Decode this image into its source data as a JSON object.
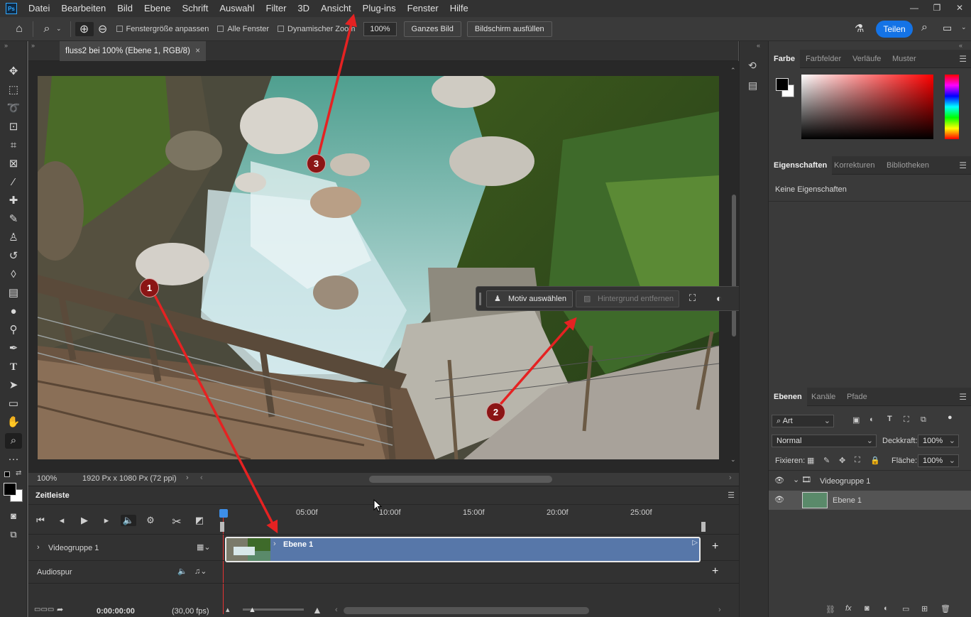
{
  "menubar": {
    "items": [
      "Datei",
      "Bearbeiten",
      "Bild",
      "Ebene",
      "Schrift",
      "Auswahl",
      "Filter",
      "3D",
      "Ansicht",
      "Plug-ins",
      "Fenster",
      "Hilfe"
    ]
  },
  "options": {
    "fit_window": "Fenstergröße anpassen",
    "all_windows": "Alle Fenster",
    "scrubby_zoom": "Dynamischer Zoom",
    "zoom_value": "100%",
    "fit_screen": "Ganzes Bild",
    "fill_screen": "Bildschirm ausfüllen",
    "share": "Teilen"
  },
  "document": {
    "tab_title": "fluss2 bei 100% (Ebene 1, RGB/8)",
    "tab_close": "×"
  },
  "status": {
    "zoom": "100%",
    "info": "1920 Px x 1080 Px (72 ppi)"
  },
  "context_taskbar": {
    "select_subject": "Motiv auswählen",
    "remove_background": "Hintergrund entfernen",
    "more": "···"
  },
  "timeline": {
    "title": "Zeitleiste",
    "ruler": [
      "05:00f",
      "10:00f",
      "15:00f",
      "20:00f",
      "25:00f"
    ],
    "video_group": "Videogruppe 1",
    "clip_name": "Ebene 1",
    "audio_track": "Audiospur",
    "timecode": "0:00:00:00",
    "fps": "(30,00 fps)",
    "add": "+"
  },
  "panels": {
    "color_tabs": [
      "Farbe",
      "Farbfelder",
      "Verläufe",
      "Muster"
    ],
    "props_tabs": [
      "Eigenschaften",
      "Korrekturen",
      "Bibliotheken"
    ],
    "props_empty": "Keine Eigenschaften",
    "layers_tabs": [
      "Ebenen",
      "Kanäle",
      "Pfade"
    ],
    "filter_kind": "Art",
    "blend_mode": "Normal",
    "opacity_label": "Deckkraft:",
    "opacity_value": "100%",
    "lock_label": "Fixieren:",
    "fill_label": "Fläche:",
    "fill_value": "100%",
    "layers": [
      {
        "name": "Videogruppe 1"
      },
      {
        "name": "Ebene 1"
      }
    ]
  },
  "annotations": {
    "markers": [
      "1",
      "2",
      "3"
    ],
    "color": "#e52222"
  },
  "colors": {
    "accent": "#1473e6",
    "clip": "#5777a9",
    "playhead": "#e53333"
  }
}
